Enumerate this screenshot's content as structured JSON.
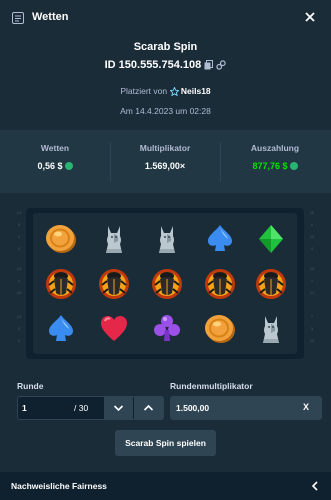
{
  "header": {
    "title": "Wetten",
    "icon": "bet-slip-icon",
    "close_icon": "close-icon"
  },
  "bet": {
    "game": "Scarab Spin",
    "id": "ID 150.555.754.108",
    "placed_prefix": "Platziert von",
    "user": "Neils18",
    "date": "Am 14.4.2023 um 02:28"
  },
  "stats": {
    "bet_label": "Wetten",
    "bet_value": "0,56 $",
    "multiplier_label": "Multiplikator",
    "multiplier_value": "1.569,00×",
    "payout_label": "Auszahlung",
    "payout_value": "877,76 $",
    "colors": {
      "payout": "#00e701",
      "coin": "#29b472"
    }
  },
  "reels": {
    "rows": [
      [
        "coin",
        "cat",
        "cat",
        "spade-blue",
        "diamond-green"
      ],
      [
        "scarab",
        "scarab",
        "scarab",
        "scarab",
        "scarab"
      ],
      [
        "spade-blue",
        "heart-red",
        "club-purple",
        "coin",
        "cat"
      ]
    ]
  },
  "round": {
    "label": "Runde",
    "value": "1",
    "total": "/ 30"
  },
  "round_multiplier": {
    "label": "Rundenmultiplikator",
    "value": "1.500,00",
    "clear": "X"
  },
  "play_button": "Scarab Spin spielen",
  "footer": {
    "label": "Nachweisliche Fairness"
  }
}
